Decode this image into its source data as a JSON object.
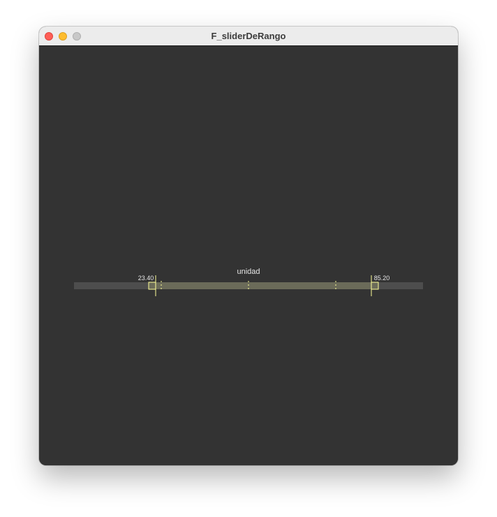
{
  "window": {
    "title": "F_sliderDeRango"
  },
  "slider": {
    "label": "unidad",
    "low_value": "23.40",
    "high_value": "85.20",
    "low_fraction": 0.234,
    "high_fraction": 0.852,
    "tick_fractions": [
      0.25,
      0.5,
      0.75
    ],
    "colors": {
      "track": "#4d4d4d",
      "range": "#6b6b59",
      "handle": "#ffff99",
      "handle_fill": "#6b6b59",
      "text": "#e6e6e6",
      "background": "#333333"
    }
  }
}
